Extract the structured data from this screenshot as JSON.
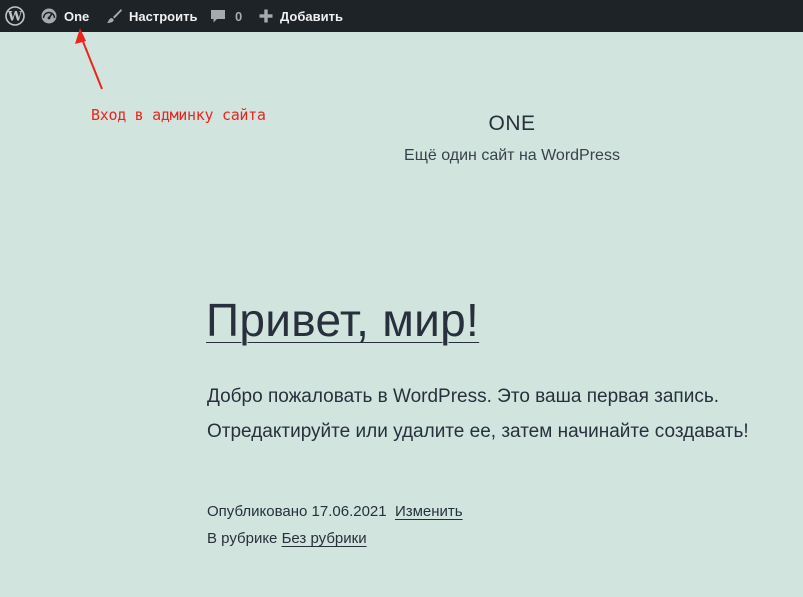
{
  "admin_bar": {
    "wp_logo_icon": "wordpress-icon",
    "site_name": "One",
    "site_icon": "dashboard-icon",
    "customize_label": "Настроить",
    "customize_icon": "brush-icon",
    "comments_count": "0",
    "comments_icon": "comment-icon",
    "new_label": "Добавить",
    "new_icon": "plus-icon"
  },
  "annotation": {
    "text": "Вход в админку сайта",
    "color": "#e8261f"
  },
  "site": {
    "title": "ONE",
    "description": "Ещё один сайт на WordPress"
  },
  "post": {
    "title": "Привет, мир!",
    "body_line1": "Добро пожаловать в WordPress. Это ваша первая запись.",
    "body_line2": "Отредактируйте или удалите ее, затем начинайте создавать!",
    "published_prefix": "Опубликовано",
    "published_date": "17.06.2021",
    "edit_link": "Изменить",
    "category_prefix": "В рубрике",
    "category_link": "Без рубрики"
  },
  "colors": {
    "page_background": "#d1e4dd",
    "admin_bar_background": "#1d2327",
    "text": "#28303d"
  }
}
